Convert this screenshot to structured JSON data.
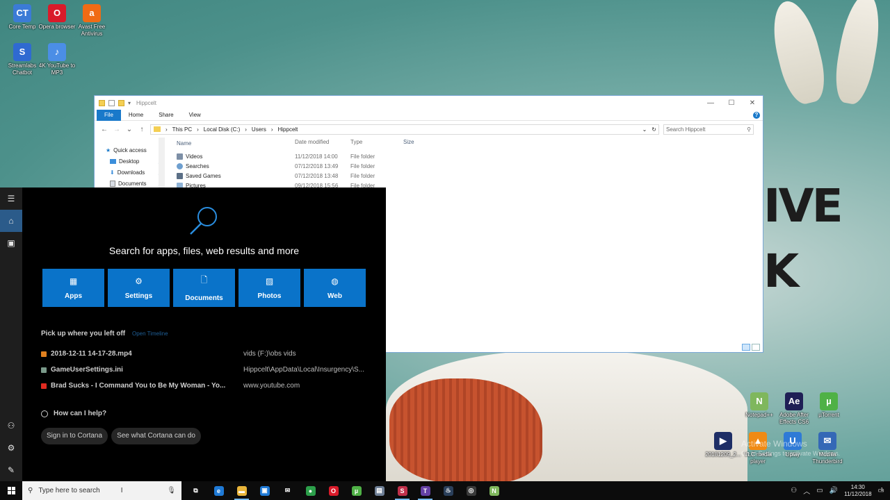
{
  "desktop": {
    "icons_left": [
      {
        "label": "Core Temp",
        "icon": "core-temp-icon",
        "color": "#3b7bd6",
        "glyph": "CT"
      },
      {
        "label": "Opera browser",
        "icon": "opera-icon",
        "color": "#d91b2a",
        "glyph": "O"
      },
      {
        "label": "Avast Free Antivirus",
        "icon": "avast-icon",
        "color": "#f06b14",
        "glyph": "a"
      },
      {
        "label": "Streamlabs Chatbot",
        "icon": "streamlabs-icon",
        "color": "#2f6ad1",
        "glyph": "S"
      },
      {
        "label": "4K YouTube to MP3",
        "icon": "4k-youtube-icon",
        "color": "#4b8ee6",
        "glyph": "♪"
      }
    ],
    "icons_right": [
      {
        "label": "Notepad++",
        "icon": "notepad-plus-icon",
        "color": "#7fb75d",
        "glyph": "N"
      },
      {
        "label": "Adobe After Effects CS6",
        "icon": "after-effects-icon",
        "color": "#1f1f55",
        "glyph": "Ae"
      },
      {
        "label": "µTorrent",
        "icon": "utorrent-icon",
        "color": "#4fb146",
        "glyph": "µ"
      },
      {
        "label": "20181209_2...",
        "icon": "video-file-icon",
        "color": "#1e2e66",
        "glyph": "▶"
      },
      {
        "label": "VLC media player",
        "icon": "vlc-icon",
        "color": "#f08a14",
        "glyph": "▲"
      },
      {
        "label": "Uplay",
        "icon": "uplay-icon",
        "color": "#2f7ad6",
        "glyph": "U"
      },
      {
        "label": "Mozilla Thunderbird",
        "icon": "thunderbird-icon",
        "color": "#3468b6",
        "glyph": "✉"
      }
    ],
    "activate": {
      "title": "Activate Windows",
      "subtitle": "Go to Settings to activate Windows."
    }
  },
  "explorer": {
    "title": "Hippcelt",
    "ribbon_tabs": [
      "File",
      "Home",
      "Share",
      "View"
    ],
    "breadcrumb": [
      "This PC",
      "Local Disk (C:)",
      "Users",
      "Hippcelt"
    ],
    "search_placeholder": "Search Hippcelt",
    "nav": [
      {
        "label": "Quick access",
        "pinned": false
      },
      {
        "label": "Desktop",
        "pinned": true
      },
      {
        "label": "Downloads",
        "pinned": true
      },
      {
        "label": "Documents",
        "pinned": true
      }
    ],
    "columns": [
      "Name",
      "Date modified",
      "Type",
      "Size"
    ],
    "rows": [
      {
        "name": "Videos",
        "date": "11/12/2018 14:00",
        "type": "File folder",
        "size": ""
      },
      {
        "name": "Searches",
        "date": "07/12/2018 13:49",
        "type": "File folder",
        "size": ""
      },
      {
        "name": "Saved Games",
        "date": "07/12/2018 13:48",
        "type": "File folder",
        "size": ""
      },
      {
        "name": "Pictures",
        "date": "09/12/2018 15:56",
        "type": "File folder",
        "size": ""
      }
    ]
  },
  "search_panel": {
    "prompt": "Search for apps, files, web results and more",
    "tiles": [
      {
        "label": "Apps",
        "icon": "apps-icon",
        "glyph": "▦"
      },
      {
        "label": "Settings",
        "icon": "settings-gear-icon",
        "glyph": "⚙"
      },
      {
        "label": "Documents",
        "icon": "document-icon",
        "glyph": "🗋"
      },
      {
        "label": "Photos",
        "icon": "photo-icon",
        "glyph": "▨"
      },
      {
        "label": "Web",
        "icon": "globe-icon",
        "glyph": "◍"
      }
    ],
    "recent_title": "Pick up where you left off",
    "timeline_link": "Open Timeline",
    "recent": [
      {
        "name": "2018-12-11 14-17-28.mp4",
        "path": "vids (F:)\\obs vids",
        "color": "#e0801f"
      },
      {
        "name": "GameUserSettings.ini",
        "path": "Hippcelt\\AppData\\Local\\Insurgency\\S...",
        "color": "#7a9a8a"
      },
      {
        "name": "Brad Sucks - I Command You to Be My Woman - Yo...",
        "path": "www.youtube.com",
        "color": "#e02a20"
      }
    ],
    "help": "How can I help?",
    "buttons": [
      "Sign in to Cortana",
      "See what Cortana can do"
    ]
  },
  "taskbar": {
    "search_placeholder": "Type here to search",
    "apps": [
      {
        "name": "task-view",
        "glyph": "⧉",
        "color": "transparent",
        "open": false
      },
      {
        "name": "edge",
        "glyph": "e",
        "color": "#1f7ad6",
        "open": false
      },
      {
        "name": "file-explorer",
        "glyph": "▬",
        "color": "#e9b53a",
        "open": true
      },
      {
        "name": "store",
        "glyph": "▣",
        "color": "#1f7ad6",
        "open": false
      },
      {
        "name": "mail",
        "glyph": "✉",
        "color": "transparent",
        "open": false
      },
      {
        "name": "chrome",
        "glyph": "●",
        "color": "#2c9f4a",
        "open": false
      },
      {
        "name": "opera",
        "glyph": "O",
        "color": "#d91b2a",
        "open": false
      },
      {
        "name": "utorrent",
        "glyph": "µ",
        "color": "#4fb146",
        "open": false
      },
      {
        "name": "app-generic",
        "glyph": "▤",
        "color": "#6e7f96",
        "open": false
      },
      {
        "name": "streamlabs-obs",
        "glyph": "S",
        "color": "#c0304a",
        "open": true
      },
      {
        "name": "twitch",
        "glyph": "T",
        "color": "#6441a5",
        "open": true
      },
      {
        "name": "steam",
        "glyph": "♨",
        "color": "#2a3f5a",
        "open": false
      },
      {
        "name": "obs",
        "glyph": "◎",
        "color": "#3a3a3a",
        "open": false
      },
      {
        "name": "notepad-plus",
        "glyph": "N",
        "color": "#7fb75d",
        "open": false
      }
    ],
    "time": "14:30",
    "date": "11/12/2018",
    "notifications": "1"
  }
}
